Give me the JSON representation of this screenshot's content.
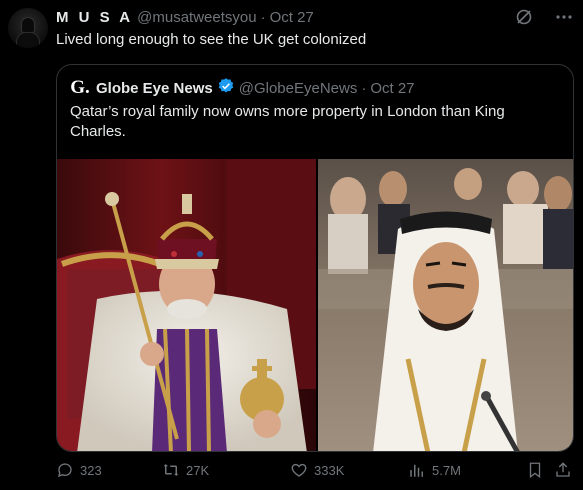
{
  "tweet": {
    "author_name": "M U S A",
    "author_handle": "@musatweetsyou",
    "separator": "·",
    "date": "Oct 27",
    "text": "Lived long enough to see the UK get colonized"
  },
  "quoted": {
    "logo_letter": "G.",
    "author_name": "Globe Eye News",
    "author_handle": "@GlobeEyeNews",
    "separator": "·",
    "date": "Oct 27",
    "text": "Qatar’s royal family now owns more property in London than King Charles."
  },
  "actions": {
    "replies": "323",
    "reposts": "27K",
    "likes": "333K",
    "views": "5.7M"
  },
  "colors": {
    "background": "#000000",
    "text": "#e7e9ea",
    "muted": "#71767b",
    "border": "#2f3336",
    "verified": "#1d9bf0"
  },
  "icons": [
    "grok-icon",
    "more-icon",
    "verified-badge-icon",
    "reply-icon",
    "repost-icon",
    "like-icon",
    "views-icon",
    "bookmark-icon",
    "share-icon"
  ]
}
